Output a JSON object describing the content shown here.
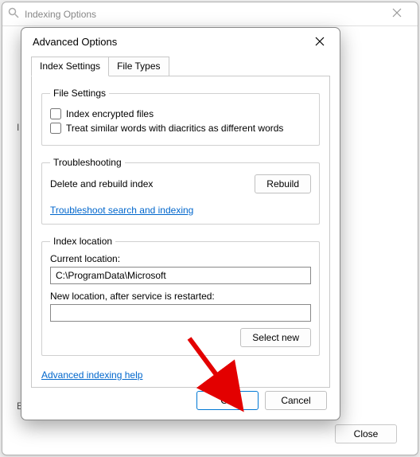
{
  "parent": {
    "title": "Indexing Options",
    "close_button": "Close"
  },
  "dialog": {
    "title": "Advanced Options",
    "tabs": {
      "settings": "Index Settings",
      "filetypes": "File Types"
    },
    "file_settings": {
      "legend": "File Settings",
      "encrypted": "Index encrypted files",
      "diacritics": "Treat similar words with diacritics as different words"
    },
    "troubleshooting": {
      "legend": "Troubleshooting",
      "delete_rebuild": "Delete and rebuild index",
      "rebuild_button": "Rebuild",
      "link": "Troubleshoot search and indexing"
    },
    "index_location": {
      "legend": "Index location",
      "current_label": "Current location:",
      "current_value": "C:\\ProgramData\\Microsoft",
      "new_label": "New location, after service is restarted:",
      "new_value": "",
      "select_new": "Select new"
    },
    "help_link": "Advanced indexing help",
    "ok": "OK",
    "cancel": "Cancel"
  }
}
